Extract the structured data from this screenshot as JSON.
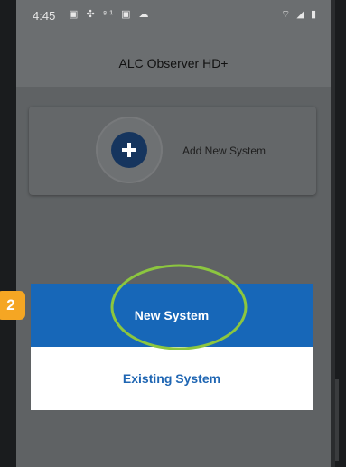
{
  "status_bar": {
    "time": "4:45",
    "left_icons": "▣ ✣ ⁸¹ ▣ ☁",
    "right_icons": "⌔ ◢ ▮"
  },
  "app_bar": {
    "title": "ALC Observer HD+"
  },
  "add_card": {
    "icon": "plus-icon",
    "label": "Add New System"
  },
  "dialog": {
    "options": [
      {
        "label": "New System",
        "selected": true
      },
      {
        "label": "Existing System",
        "selected": false
      }
    ]
  },
  "annotation": {
    "step_number": "2",
    "highlight_color": "#8cc63f"
  },
  "colors": {
    "dialog_primary": "#1767b8",
    "dialog_secondary_text": "#1f66b3",
    "step_badge": "#f5a623",
    "add_button": "#16355e"
  }
}
